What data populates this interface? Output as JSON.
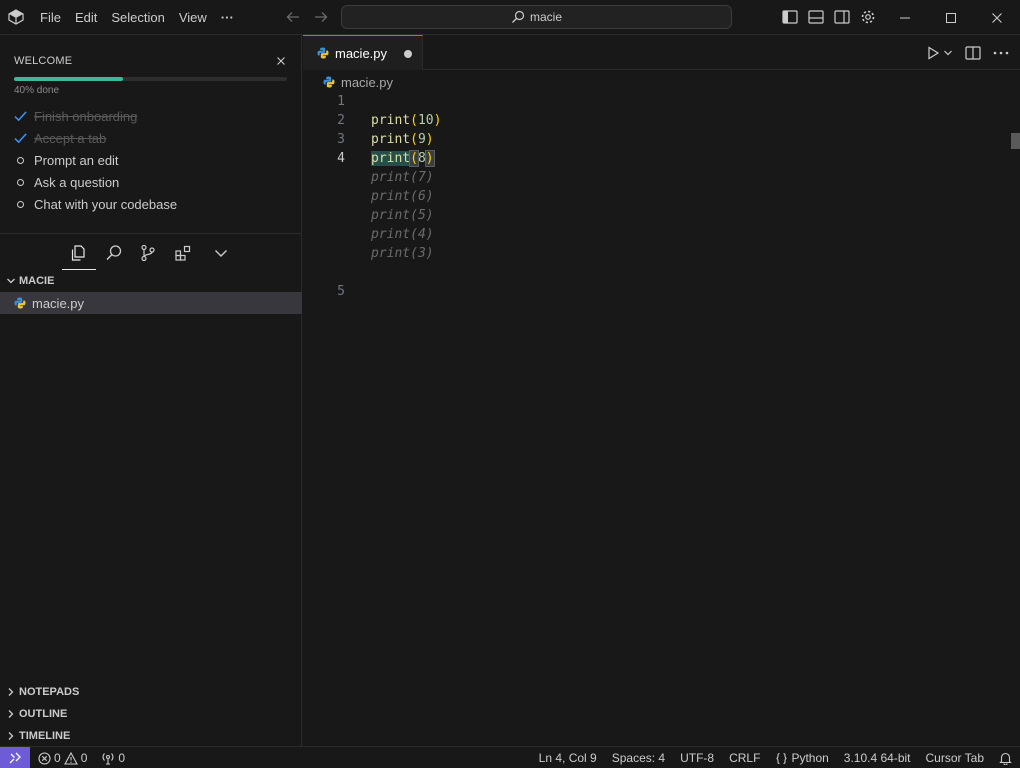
{
  "titlebar": {
    "menu": [
      "File",
      "Edit",
      "Selection",
      "View"
    ],
    "more_label": "···",
    "search_text": "macie"
  },
  "welcome": {
    "title": "WELCOME",
    "progress_fraction": 0.4,
    "progress_text": "40% done",
    "items": [
      {
        "label": "Finish onboarding",
        "done": true
      },
      {
        "label": "Accept a tab",
        "done": true
      },
      {
        "label": "Prompt an edit",
        "done": false
      },
      {
        "label": "Ask a question",
        "done": false
      },
      {
        "label": "Chat with your codebase",
        "done": false
      }
    ]
  },
  "explorer": {
    "folder": "MACIE",
    "file": "macie.py"
  },
  "panels": [
    "NOTEPADS",
    "OUTLINE",
    "TIMELINE"
  ],
  "editor": {
    "tab_label": "macie.py",
    "breadcrumb": "macie.py",
    "lines": [
      {
        "n": "1",
        "text": ""
      },
      {
        "n": "2",
        "fn": "print",
        "arg": "10"
      },
      {
        "n": "3",
        "fn": "print",
        "arg": "9"
      },
      {
        "n": "4",
        "fn": "print",
        "arg": "8",
        "active": true
      },
      {
        "n": "",
        "ghost": "print(7)"
      },
      {
        "n": "",
        "ghost": "print(6)"
      },
      {
        "n": "",
        "ghost": "print(5)"
      },
      {
        "n": "",
        "ghost": "print(4)"
      },
      {
        "n": "",
        "ghost": "print(3)"
      },
      {
        "n": "",
        "text": ""
      },
      {
        "n": "5",
        "text": ""
      }
    ]
  },
  "statusbar": {
    "errors": "0",
    "warnings": "0",
    "ports": "0",
    "position": "Ln 4, Col 9",
    "spaces": "Spaces: 4",
    "encoding": "UTF-8",
    "eol": "CRLF",
    "language": "Python",
    "interpreter": "3.10.4 64-bit",
    "cursor_tab": "Cursor Tab"
  },
  "colors": {
    "accent": "#4b8bd6",
    "progress": "#3eb89a",
    "remote": "#6e5bd6",
    "check": "#3794ff"
  }
}
